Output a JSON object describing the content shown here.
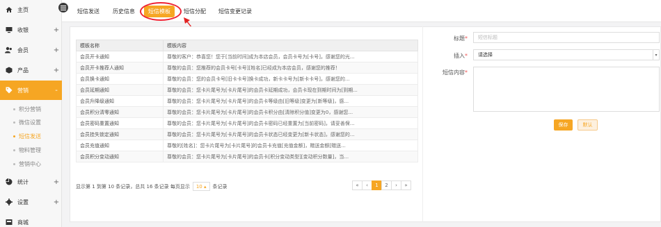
{
  "sidebar": {
    "items": [
      {
        "label": "主页",
        "icon": "home-icon",
        "toggle": ""
      },
      {
        "label": "收银",
        "icon": "monitor-icon",
        "toggle": "+"
      },
      {
        "label": "会员",
        "icon": "users-icon",
        "toggle": "+"
      },
      {
        "label": "产品",
        "icon": "box-icon",
        "toggle": "+"
      },
      {
        "label": "营销",
        "icon": "tag-icon",
        "toggle": "-"
      },
      {
        "label": "统计",
        "icon": "pie-chart-icon",
        "toggle": "+"
      },
      {
        "label": "设置",
        "icon": "gear-icon",
        "toggle": "+"
      },
      {
        "label": "商城",
        "icon": "store-icon",
        "toggle": ""
      }
    ],
    "sub_items": [
      "积分营销",
      "微信设置",
      "短信发送",
      "物料管理",
      "营销中心"
    ],
    "active_sub": "短信发送"
  },
  "tabs": [
    "短信发送",
    "历史信息",
    "短信模板",
    "短信分配",
    "短信变更记录"
  ],
  "active_tab": "短信模板",
  "table": {
    "headers": [
      "模板名称",
      "模板内容"
    ],
    "rows": [
      [
        "会员开卡通知",
        "尊敬的客户：恭喜您！您于[当前时间]成为本店会员，会员卡号为[卡号]，感谢您的光..."
      ],
      [
        "会员开卡推荐人通知",
        "尊敬的会员：您推荐的会员卡号[卡号][姓名]已经成为本店会员，感谢您的推荐！"
      ],
      [
        "会员换卡通知",
        "尊敬的会员：您的会员卡号[旧卡卡号]换卡成功，新卡卡号为[新卡卡号]，感谢您的..."
      ],
      [
        "会员延期通知",
        "尊敬的会员：您卡片尾号为[卡片尾号]的会员卡延期成功，会员卡现在到期时间为[到期..."
      ],
      [
        "会员升降级通知",
        "尊敬的会员：您卡片尾号为[卡片尾号]的会员卡等级由[旧等级]变更为[新等级]，感..."
      ],
      [
        "会员积分清零通知",
        "尊敬的会员：您卡片尾号为[卡片尾号]的会员卡积分由[清除积分值]变更为0，感谢您..."
      ],
      [
        "会员密码重置通知",
        "尊敬的会员：您卡片尾号为[卡片尾号]的会员卡密码已经重置为[当前密码]，请妥善保..."
      ],
      [
        "会员挂失锁定通知",
        "尊敬的会员：您卡片尾号为[卡片尾号]的会员卡状态已经变更为[新卡状态]，感谢您的..."
      ],
      [
        "会员充值通知",
        "尊敬的[姓名]：您卡片尾号为[卡片尾号]的会员卡充值[充值金额]，赠送金额[赠送..."
      ],
      [
        "会员积分变动通知",
        "尊敬的会员：您卡片尾号为[卡片尾号]的会员卡[积分变动类型][变动积分数量]，当..."
      ]
    ]
  },
  "pagination": {
    "info_prefix": "显示第 1 到第 10 条记录，总共 16 条记录 每页显示",
    "page_size": "10",
    "info_suffix": "条记录",
    "buttons": [
      "«",
      "‹",
      "1",
      "2",
      "›",
      "»"
    ],
    "active": "1"
  },
  "form": {
    "title_label": "标题",
    "title_placeholder": "短信标题",
    "insert_label": "插入",
    "insert_value": "请选择",
    "content_label": "短信内容",
    "required_mark": "*",
    "save_label": "保存",
    "default_label": "默认"
  },
  "colors": {
    "accent": "#f6a623",
    "highlight": "#e22222"
  }
}
